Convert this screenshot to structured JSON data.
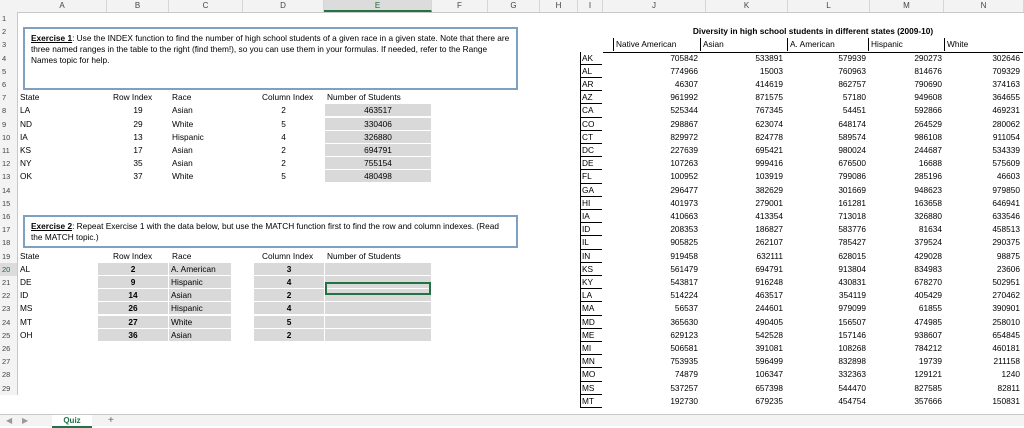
{
  "columns": [
    "A",
    "B",
    "C",
    "D",
    "E",
    "F",
    "G",
    "H",
    "I",
    "J",
    "K",
    "L",
    "M",
    "N"
  ],
  "rows": [
    "1",
    "2",
    "3",
    "4",
    "5",
    "6",
    "7",
    "8",
    "9",
    "10",
    "11",
    "12",
    "13",
    "14",
    "15",
    "16",
    "17",
    "18",
    "19",
    "20",
    "21",
    "22",
    "23",
    "24",
    "25",
    "26",
    "27",
    "28",
    "29"
  ],
  "exercise1": {
    "label": "Exercise 1",
    "text": ": Use the INDEX function to find the number of high school  students of a given race in a given state. Note that there are three named ranges in the table to the right (find them!), so you can use them in your formulas.  If needed, refer to the Range Names topic for help."
  },
  "exercise2": {
    "label": "Exercise 2",
    "text": ": Repeat Exercise 1 with the data below, but use the MATCH function first to find the row and column indexes. (Read the MATCH topic.)"
  },
  "table1": {
    "headers": {
      "state": "State",
      "row_index": "Row Index",
      "race": "Race",
      "col_index": "Column Index",
      "num_students": "Number of Students"
    },
    "rows": [
      {
        "state": "LA",
        "row_index": "19",
        "race": "Asian",
        "col_index": "2",
        "num_students": "463517"
      },
      {
        "state": "ND",
        "row_index": "29",
        "race": "White",
        "col_index": "5",
        "num_students": "330406"
      },
      {
        "state": "IA",
        "row_index": "13",
        "race": "Hispanic",
        "col_index": "4",
        "num_students": "326880"
      },
      {
        "state": "KS",
        "row_index": "17",
        "race": "Asian",
        "col_index": "2",
        "num_students": "694791"
      },
      {
        "state": "NY",
        "row_index": "35",
        "race": "Asian",
        "col_index": "2",
        "num_students": "755154"
      },
      {
        "state": "OK",
        "row_index": "37",
        "race": "White",
        "col_index": "5",
        "num_students": "480498"
      }
    ]
  },
  "table2": {
    "headers": {
      "state": "State",
      "row_index": "Row Index",
      "race": "Race",
      "col_index": "Column Index",
      "num_students": "Number of Students"
    },
    "rows": [
      {
        "state": "AL",
        "row_index": "2",
        "race": "A. American",
        "col_index": "3"
      },
      {
        "state": "DE",
        "row_index": "9",
        "race": "Hispanic",
        "col_index": "4"
      },
      {
        "state": "ID",
        "row_index": "14",
        "race": "Asian",
        "col_index": "2"
      },
      {
        "state": "MS",
        "row_index": "26",
        "race": "Hispanic",
        "col_index": "4"
      },
      {
        "state": "MT",
        "row_index": "27",
        "race": "White",
        "col_index": "5"
      },
      {
        "state": "OH",
        "row_index": "36",
        "race": "Asian",
        "col_index": "2"
      }
    ]
  },
  "diversity": {
    "title": "Diversity in high school students in different states (2009-10)",
    "headers": [
      "Native American",
      "Asian",
      "A. American",
      "Hispanic",
      "White"
    ],
    "rows": [
      [
        "AK",
        "705842",
        "533891",
        "579939",
        "290273",
        "302646"
      ],
      [
        "AL",
        "774966",
        "15003",
        "760963",
        "814676",
        "709329"
      ],
      [
        "AR",
        "46307",
        "414619",
        "862757",
        "790690",
        "374163"
      ],
      [
        "AZ",
        "961992",
        "871575",
        "57180",
        "949608",
        "364655"
      ],
      [
        "CA",
        "525344",
        "767345",
        "54451",
        "592866",
        "469231"
      ],
      [
        "CO",
        "298867",
        "623074",
        "648174",
        "264529",
        "280062"
      ],
      [
        "CT",
        "829972",
        "824778",
        "589574",
        "986108",
        "911054"
      ],
      [
        "DC",
        "227639",
        "695421",
        "980024",
        "244687",
        "534339"
      ],
      [
        "DE",
        "107263",
        "999416",
        "676500",
        "16688",
        "575609"
      ],
      [
        "FL",
        "100952",
        "103919",
        "799086",
        "285196",
        "46603"
      ],
      [
        "GA",
        "296477",
        "382629",
        "301669",
        "948623",
        "979850"
      ],
      [
        "HI",
        "401973",
        "279001",
        "161281",
        "163658",
        "646941"
      ],
      [
        "IA",
        "410663",
        "413354",
        "713018",
        "326880",
        "633546"
      ],
      [
        "ID",
        "208353",
        "186827",
        "583776",
        "81634",
        "458513"
      ],
      [
        "IL",
        "905825",
        "262107",
        "785427",
        "379524",
        "290375"
      ],
      [
        "IN",
        "919458",
        "632111",
        "628015",
        "429028",
        "98875"
      ],
      [
        "KS",
        "561479",
        "694791",
        "913804",
        "834983",
        "23606"
      ],
      [
        "KY",
        "543817",
        "916248",
        "430831",
        "678270",
        "502951"
      ],
      [
        "LA",
        "514224",
        "463517",
        "354119",
        "405429",
        "270462"
      ],
      [
        "MA",
        "56537",
        "244601",
        "979099",
        "61855",
        "390901"
      ],
      [
        "MD",
        "365630",
        "490405",
        "156507",
        "474985",
        "258010"
      ],
      [
        "ME",
        "629123",
        "542528",
        "157146",
        "938607",
        "654845"
      ],
      [
        "MI",
        "506581",
        "391081",
        "108268",
        "784212",
        "460181"
      ],
      [
        "MN",
        "753935",
        "596499",
        "832898",
        "19739",
        "211158"
      ],
      [
        "MO",
        "74879",
        "106347",
        "332363",
        "129121",
        "1240"
      ],
      [
        "MS",
        "537257",
        "657398",
        "544470",
        "827585",
        "82811"
      ],
      [
        "MT",
        "192730",
        "679235",
        "454754",
        "357666",
        "150831"
      ]
    ]
  },
  "sheet_tab": "Quiz",
  "add_sheet": "+",
  "colors": {
    "accent": "#217346",
    "gray_fill": "#d9d9d9",
    "note_border": "#7fa0c0"
  }
}
